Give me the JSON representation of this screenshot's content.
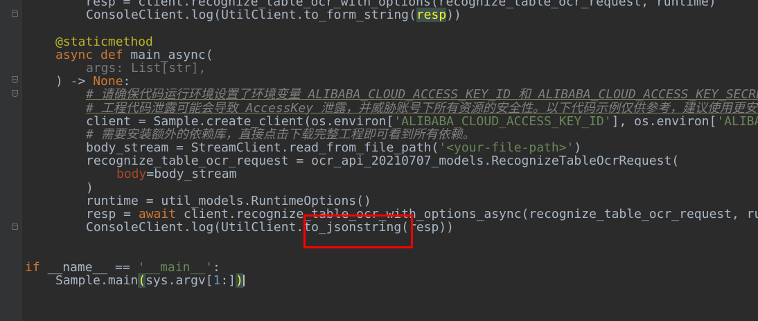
{
  "code": {
    "l1_tail": "    resp = client.recognize_table_ocr_with_options(recognize_table_ocr_request, runtime)",
    "l2_a": "ConsoleClient.log(UtilClient.to_form_string(",
    "l2_b": "resp",
    "l2_c": "))",
    "l4": "@staticmethod",
    "l5_kw": "async def ",
    "l5_fn": "main_async(",
    "l6": "args: List[str],",
    "l7_a": ") -> ",
    "l7_b": "None",
    "l7_c": ":",
    "l8": "# 请确保代码运行环境设置了环境变量 ALIBABA_CLOUD_ACCESS_KEY_ID 和 ALIBABA_CLOUD_ACCESS_KEY_SECRET",
    "l9": "# 工程代码泄露可能会导致 AccessKey 泄露，并威胁账号下所有资源的安全性。以下代码示例仅供参考，建议使用更安全的",
    "l10_a": "client = Sample.create_client(os.environ[",
    "l10_b": "'ALIBABA_CLOUD_ACCESS_KEY_ID'",
    "l10_c": "], os.environ[",
    "l10_d": "'ALIBABA_CLOUD_ACCESS_KEY_SECRET'",
    "l11": "# 需要安装额外的依赖库，直接点击下载完整工程即可看到所有依赖。",
    "l12_a": "body_stream = StreamClient.read_from_file_path(",
    "l12_b": "'<your-file-path>'",
    "l12_c": ")",
    "l13": "recognize_table_ocr_request = ocr_api_20210707_models.RecognizeTableOcrRequest(",
    "l14_a": "body",
    "l14_b": "=body_stream",
    "l15": ")",
    "l16": "runtime = util_models.RuntimeOptions()",
    "l17_a": "resp = ",
    "l17_b": "await ",
    "l17_c": "client.recognize_table_ocr_with_options_async(recognize_table_ocr_request, runtime)",
    "l18": "ConsoleClient.log(UtilClient.to_jsonstring(resp))",
    "l21_a": "if ",
    "l21_b": "__name__ == ",
    "l21_c": "'__main__'",
    "l21_d": ":",
    "l22_a": "Sample.main",
    "l22_b": "(",
    "l22_c": "sys.argv[",
    "l22_d": "1",
    "l22_e": ":]",
    "l22_f": ")"
  },
  "colors": {
    "background": "#2b2b2b",
    "gutter": "#313335",
    "default_text": "#a9b7c6",
    "keyword": "#cc7832",
    "decorator": "#bbb529",
    "string": "#6a8759",
    "number": "#6897bb",
    "comment": "#808080",
    "parameter": "#aa4926",
    "annotation_box": "#ff0000"
  },
  "icons": {
    "fold_markers": [
      "fold-open-icon",
      "fold-close-icon"
    ]
  }
}
